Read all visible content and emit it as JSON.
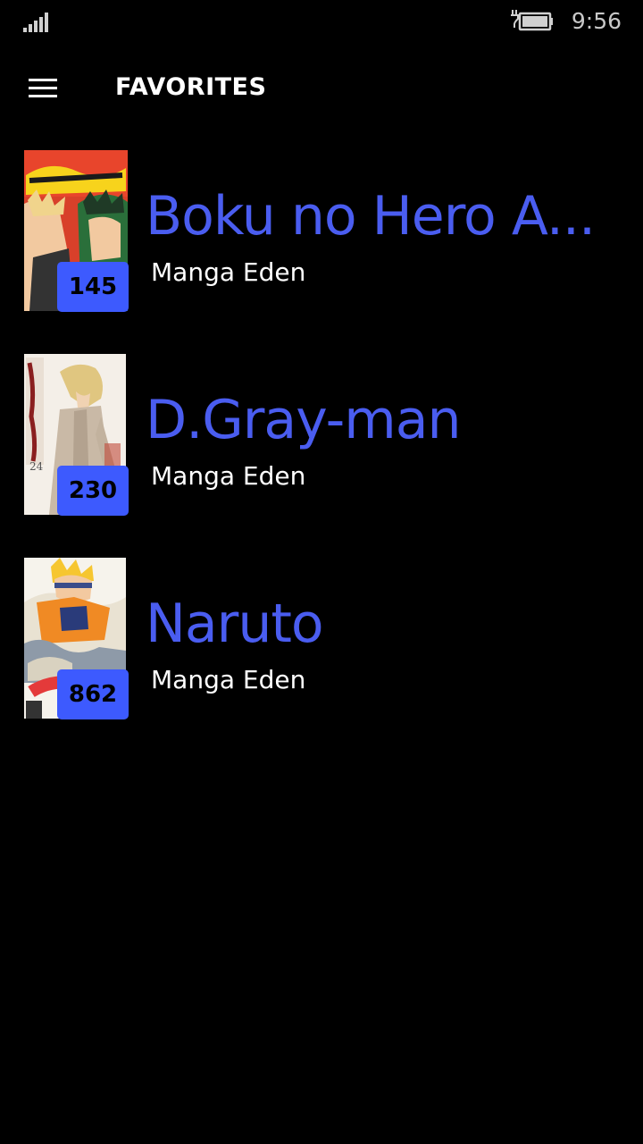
{
  "status_bar": {
    "time": "9:56",
    "signal_icon": "signal-bars-icon",
    "battery_icon": "battery-charging-icon"
  },
  "header": {
    "menu_icon": "hamburger-menu-icon",
    "title": "FAVORITES"
  },
  "colors": {
    "accent": "#3d5afe",
    "title_blue": "#4a5df0",
    "background": "#000000"
  },
  "favorites": [
    {
      "title": "Boku no Hero A...",
      "source": "Manga Eden",
      "chapters": "145"
    },
    {
      "title": "D.Gray-man",
      "source": "Manga Eden",
      "chapters": "230"
    },
    {
      "title": "Naruto",
      "source": "Manga Eden",
      "chapters": "862"
    }
  ]
}
